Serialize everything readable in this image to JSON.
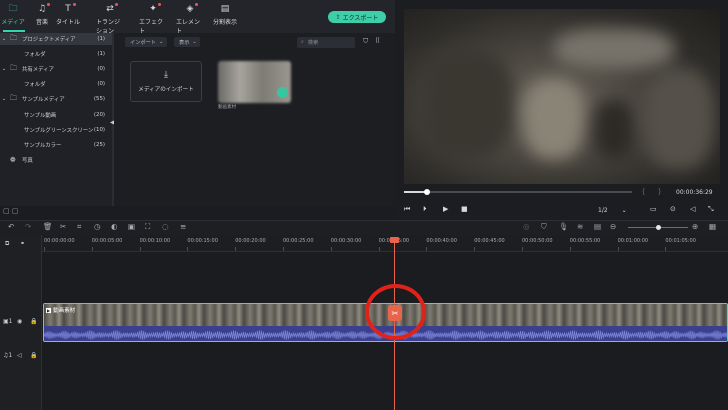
{
  "top_tabs": [
    {
      "label": "メディア",
      "icon": "folder-icon",
      "active": true
    },
    {
      "label": "音楽",
      "icon": "music-note-icon",
      "active": false
    },
    {
      "label": "タイトル",
      "icon": "text-icon",
      "active": false
    },
    {
      "label": "トランジション",
      "icon": "transition-icon",
      "active": false
    },
    {
      "label": "エフェクト",
      "icon": "sparkle-icon",
      "active": false
    },
    {
      "label": "エレメント",
      "icon": "element-icon",
      "active": false
    },
    {
      "label": "分割表示",
      "icon": "split-screen-icon",
      "active": false
    }
  ],
  "export_label": "エクスポート",
  "sidebar": {
    "items": [
      {
        "label": "プロジェクトメディア",
        "count": "(1)",
        "level": 0,
        "selected": true
      },
      {
        "label": "フォルダ",
        "count": "(1)",
        "level": 1,
        "selected": false
      },
      {
        "label": "共有メディア",
        "count": "(0)",
        "level": 0,
        "selected": false
      },
      {
        "label": "フォルダ",
        "count": "(0)",
        "level": 1,
        "selected": false
      },
      {
        "label": "サンプルメディア",
        "count": "(55)",
        "level": 0,
        "selected": false
      },
      {
        "label": "サンプル動画",
        "count": "(20)",
        "level": 1,
        "selected": false
      },
      {
        "label": "サンプルグリーンスクリーン",
        "count": "(10)",
        "level": 1,
        "selected": false
      },
      {
        "label": "サンプルカラー",
        "count": "(25)",
        "level": 1,
        "selected": false
      },
      {
        "label": "写真",
        "count": "",
        "level": 0,
        "selected": false
      }
    ]
  },
  "media": {
    "import_dropdown": "インポート",
    "sort_dropdown": "表示",
    "search_placeholder": "検索",
    "import_box_label": "メディアのインポート",
    "thumb_label": "動画素材"
  },
  "preview": {
    "timecode": "00:00:36:29",
    "ratio": "1/2",
    "progress": 0.1
  },
  "timeline": {
    "ruler": [
      "00:00:00:00",
      "00:00:05:00",
      "00:00:10:00",
      "00:00:15:00",
      "00:00:20:00",
      "00:00:25:00",
      "00:00:30:00",
      "00:00:35:00",
      "00:00:40:00",
      "00:00:45:00",
      "00:00:50:00",
      "00:00:55:00",
      "00:01:00:00",
      "00:01:05:00"
    ],
    "clip_label": "動画素材",
    "video_track": "1",
    "audio_track": "1"
  },
  "colors": {
    "accent": "#3ecfa9",
    "playhead": "#e8654d",
    "highlight_circle": "#e0231a"
  }
}
